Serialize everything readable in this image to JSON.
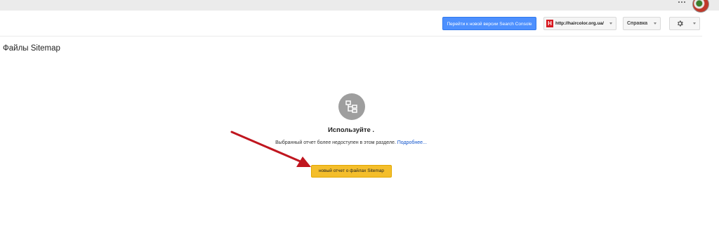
{
  "header": {
    "new_version_button": "Перейти к новой версии Search Console",
    "site_selector": "http://haircolor.org.ua/",
    "site_favicon_letter": "H",
    "help_label": "Справка"
  },
  "page": {
    "title": "Файлы Sitemap"
  },
  "empty_state": {
    "title": "Используйте .",
    "description": "Выбранный отчет более недоступен в этом разделе.",
    "more_link": "Подробнее...",
    "cta_label": "новый отчет о файлах Sitemap"
  },
  "colors": {
    "primary_button": "#4d90fe",
    "cta": "#f4be2b",
    "link": "#1155cc",
    "arrow": "#c0161f"
  }
}
